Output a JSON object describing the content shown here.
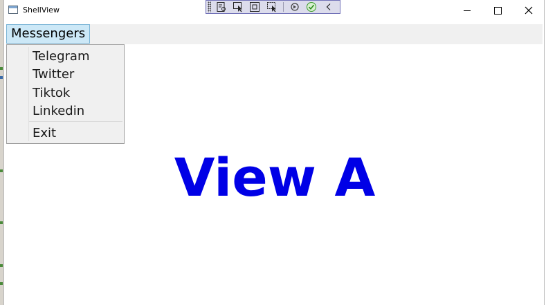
{
  "window": {
    "title": "ShellView"
  },
  "debug_toolbar": {
    "buttons": [
      {
        "icon": "live-visual-tree-icon"
      },
      {
        "icon": "select-element-icon"
      },
      {
        "icon": "display-adorners-icon"
      },
      {
        "icon": "track-focused-element-icon"
      },
      {
        "icon": "hot-reload-icon"
      },
      {
        "icon": "binding-failures-check-icon"
      },
      {
        "icon": "collapse-chevron-icon"
      }
    ]
  },
  "menubar": {
    "menu_label": "Messengers"
  },
  "dropdown": {
    "items": [
      {
        "label": "Telegram"
      },
      {
        "label": "Twitter"
      },
      {
        "label": "Tiktok"
      },
      {
        "label": "Linkedin"
      },
      {
        "label": "Exit"
      }
    ]
  },
  "content": {
    "heading": "View A"
  },
  "colors": {
    "heading": "#0000e6",
    "menubar_bg": "#f0f0f0",
    "menu_highlight_bg": "#cce8f7",
    "menu_highlight_border": "#7ab4d6",
    "debug_toolbar_bg": "#dcdcec"
  }
}
